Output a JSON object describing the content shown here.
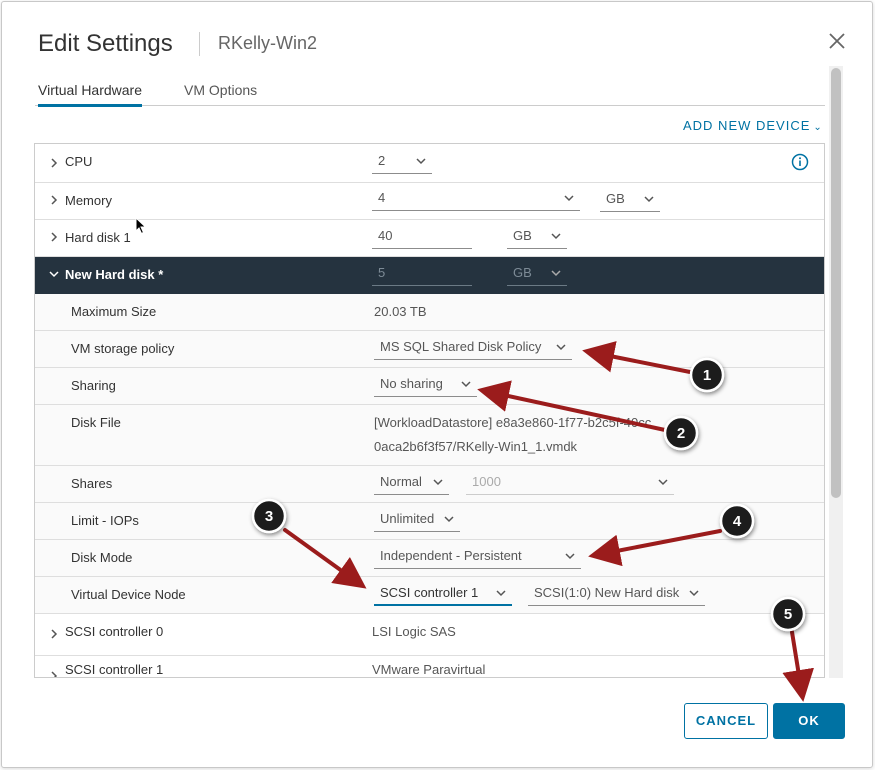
{
  "dialog": {
    "title": "Edit Settings",
    "subtitle": "RKelly-Win2"
  },
  "tabs": [
    {
      "label": "Virtual Hardware",
      "active": true
    },
    {
      "label": "VM Options",
      "active": false
    }
  ],
  "add_device": {
    "label": "ADD NEW DEVICE"
  },
  "hardware": {
    "cpu": {
      "label": "CPU",
      "value": "2"
    },
    "memory": {
      "label": "Memory",
      "value": "4",
      "unit": "GB"
    },
    "hard_disk_1": {
      "label": "Hard disk 1",
      "value": "40",
      "unit": "GB"
    },
    "new_hard_disk": {
      "label": "New Hard disk *",
      "value": "5",
      "unit": "GB",
      "fields": {
        "max_size": {
          "label": "Maximum Size",
          "value": "20.03 TB"
        },
        "storage_policy": {
          "label": "VM storage policy",
          "value": "MS SQL Shared Disk Policy"
        },
        "sharing": {
          "label": "Sharing",
          "value": "No sharing"
        },
        "disk_file": {
          "label": "Disk File",
          "line1": "[WorkloadDatastore] e8a3e860-1f77-b2c5f-40cc",
          "line2": "0aca2b6f3f57/RKelly-Win1_1.vmdk"
        },
        "shares": {
          "label": "Shares",
          "value": "Normal",
          "amount": "1000"
        },
        "limit_iops": {
          "label": "Limit - IOPs",
          "value": "Unlimited"
        },
        "disk_mode": {
          "label": "Disk Mode",
          "value": "Independent - Persistent"
        },
        "device_node": {
          "label": "Virtual Device Node",
          "controller": "SCSI controller 1",
          "node": "SCSI(1:0) New Hard disk"
        }
      }
    },
    "scsi_controller_0": {
      "label": "SCSI controller 0",
      "value": "LSI Logic SAS"
    },
    "scsi_controller_1": {
      "label": "SCSI controller 1",
      "value": "VMware Paravirtual"
    }
  },
  "buttons": {
    "cancel": "CANCEL",
    "ok": "OK"
  },
  "callouts": [
    "1",
    "2",
    "3",
    "4",
    "5"
  ],
  "colors": {
    "accent": "#0072a3",
    "dark_header": "#25333f",
    "arrow": "#9b1c1c"
  }
}
